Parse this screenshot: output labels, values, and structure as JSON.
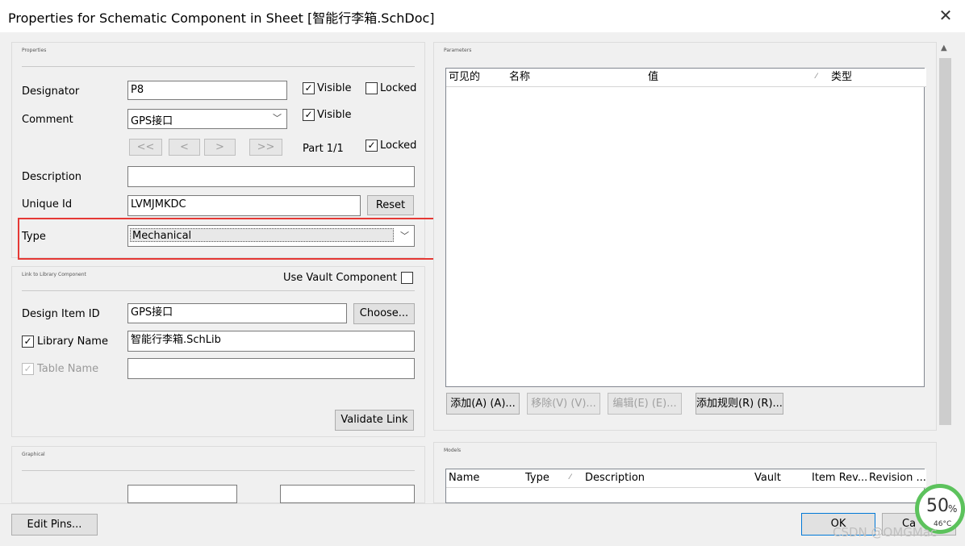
{
  "window": {
    "title": "Properties for Schematic Component in Sheet [智能行李箱.SchDoc]"
  },
  "properties": {
    "group_title": "Properties",
    "designator": {
      "label": "Designator",
      "value": "P8",
      "visible_label": "Visible",
      "visible": true,
      "locked_label": "Locked",
      "locked": false
    },
    "comment": {
      "label": "Comment",
      "value": "GPS接口",
      "visible_label": "Visible",
      "visible": true
    },
    "part_nav": {
      "first": "<<",
      "prev": "<",
      "next": ">",
      "last": ">>",
      "part_label": "Part 1/1",
      "locked_label": "Locked",
      "locked": true
    },
    "description": {
      "label": "Description",
      "value": ""
    },
    "unique_id": {
      "label": "Unique Id",
      "value": "LVMJMKDC",
      "reset_label": "Reset"
    },
    "type": {
      "label": "Type",
      "value": "Mechanical"
    }
  },
  "library_link": {
    "group_title": "Link to Library Component",
    "use_vault_label": "Use Vault Component",
    "use_vault": false,
    "design_item": {
      "label": "Design Item ID",
      "value": "GPS接口",
      "choose_label": "Choose..."
    },
    "library_name": {
      "label": "Library Name",
      "value": "智能行李箱.SchLib",
      "checked": true
    },
    "table_name": {
      "label": "Table Name",
      "value": "",
      "checked": true
    },
    "validate_label": "Validate Link"
  },
  "graphical": {
    "group_title": "Graphical"
  },
  "parameters": {
    "group_title": "Parameters",
    "columns": [
      "可见的",
      "名称",
      "值",
      "类型"
    ],
    "buttons": {
      "add": "添加(A) (A)...",
      "remove": "移除(V) (V)...",
      "edit": "编辑(E) (E)...",
      "add_rule": "添加规则(R) (R)..."
    }
  },
  "models": {
    "group_title": "Models",
    "columns": [
      "Name",
      "Type",
      "Description",
      "Vault",
      "Item Rev...",
      "Revision ..."
    ]
  },
  "footer": {
    "edit_pins": "Edit Pins...",
    "ok": "OK",
    "cancel": "Ca"
  },
  "overlay": {
    "gauge_value": "50",
    "gauge_unit": "%",
    "temp": "46°C",
    "watermark": "CSDN @OMGMac"
  },
  "icons": {
    "close": "close-icon",
    "dropdown": "chevron-down-icon",
    "check": "check-icon",
    "sort": "sort-icon"
  },
  "colors": {
    "highlight": "#e53935",
    "gauge": "#5cc25c"
  }
}
